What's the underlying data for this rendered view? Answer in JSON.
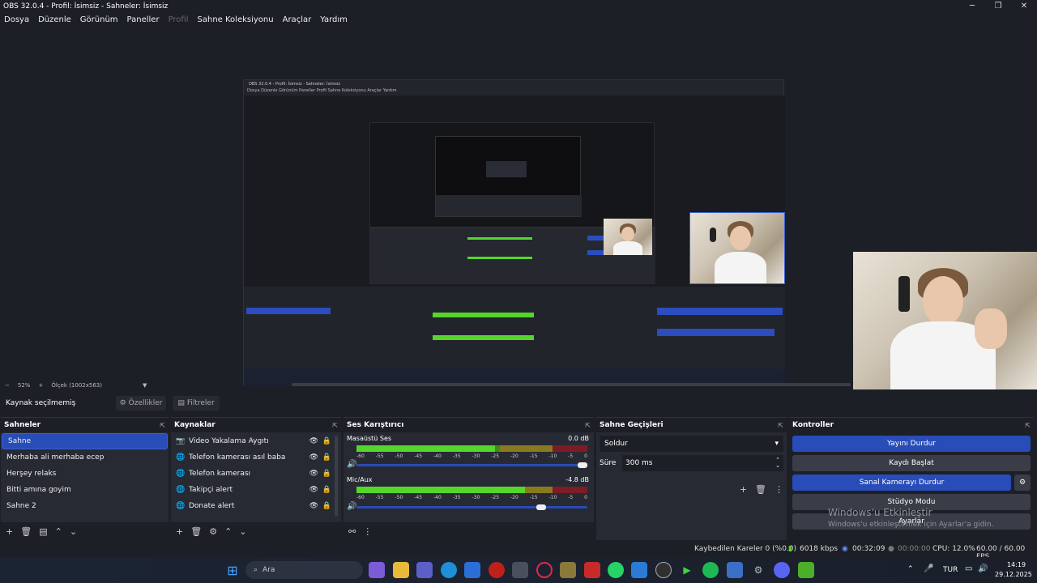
{
  "window": {
    "title": "OBS 32.0.4 - Profil: İsimsiz - Sahneler: İsimsiz"
  },
  "menu": [
    {
      "label": "Dosya",
      "disabled": false
    },
    {
      "label": "Düzenle",
      "disabled": false
    },
    {
      "label": "Görünüm",
      "disabled": false
    },
    {
      "label": "Paneller",
      "disabled": false
    },
    {
      "label": "Profil",
      "disabled": true
    },
    {
      "label": "Sahne Koleksiyonu",
      "disabled": false
    },
    {
      "label": "Araçlar",
      "disabled": false
    },
    {
      "label": "Yardım",
      "disabled": false
    }
  ],
  "zoom": {
    "minus": "−",
    "percent": "52%",
    "plus": "+",
    "mode": "Ölçek (1002x563)",
    "chevron": "▼"
  },
  "source_bar": {
    "status": "Kaynak seçilmemiş",
    "properties": "Özellikler",
    "filters": "Filtreler"
  },
  "scenes": {
    "title": "Sahneler",
    "items": [
      "Sahne",
      "Merhaba ali merhaba ecep",
      "Herşey relaks",
      "Bitti amına goyim",
      "Sahne 2"
    ],
    "selected": 0
  },
  "sources": {
    "title": "Kaynaklar",
    "items": [
      {
        "label": "Video Yakalama Aygıtı",
        "icon": "camera-icon"
      },
      {
        "label": "Telefon kamerası asıl baba",
        "icon": "globe-icon"
      },
      {
        "label": "Telefon kamerası",
        "icon": "globe-icon"
      },
      {
        "label": "Takipçi alert",
        "icon": "globe-icon"
      },
      {
        "label": "Donate alert",
        "icon": "globe-icon"
      }
    ]
  },
  "mixer": {
    "title": "Ses Karıştırıcı",
    "channels": [
      {
        "name": "Masaüstü Ses",
        "db": "0.0 dB",
        "level_fraction": 0.6,
        "volume_fraction": 1.0
      },
      {
        "name": "Mic/Aux",
        "db": "-4.8 dB",
        "level_fraction": 0.73,
        "volume_fraction": 0.82
      }
    ],
    "scale": [
      "-60",
      "-55",
      "-50",
      "-45",
      "-40",
      "-35",
      "-30",
      "-25",
      "-20",
      "-15",
      "-10",
      "-5",
      "0"
    ]
  },
  "transitions": {
    "title": "Sahne Geçişleri",
    "selected": "Soldur",
    "duration_label": "Süre",
    "duration_value": "300 ms"
  },
  "controls": {
    "title": "Kontroller",
    "stop_stream": "Yayını Durdur",
    "start_record": "Kaydı Başlat",
    "stop_virtualcam": "Sanal Kamerayı Durdur",
    "studio_mode": "Stüdyo Modu",
    "settings": "Ayarlar"
  },
  "activation": {
    "line1": "Windows'u Etkinleştir",
    "line2": "Windows'u etkinleştirmek için Ayarlar'a gidin."
  },
  "status": {
    "dropped": "Kaybedilen Kareler 0 (%0.0)",
    "bitrate": "6018 kbps",
    "stream_time": "00:32:09",
    "record_time": "00:00:00",
    "cpu": "CPU: 12.0%",
    "fps": "60.00 / 60.00 FPS"
  },
  "taskbar": {
    "search": "Ara",
    "lang": "TUR",
    "time": "14:19",
    "date": "29.12.2025"
  },
  "nested": {
    "title": "OBS 32.0.4 - Profil: İsimsiz - Sahneler: İsimsiz",
    "menu": "Dosya  Düzenle  Görünüm  Paneller  Profil  Sahne Koleksiyonu  Araçlar  Yardım"
  },
  "ud_icon": "⇱"
}
